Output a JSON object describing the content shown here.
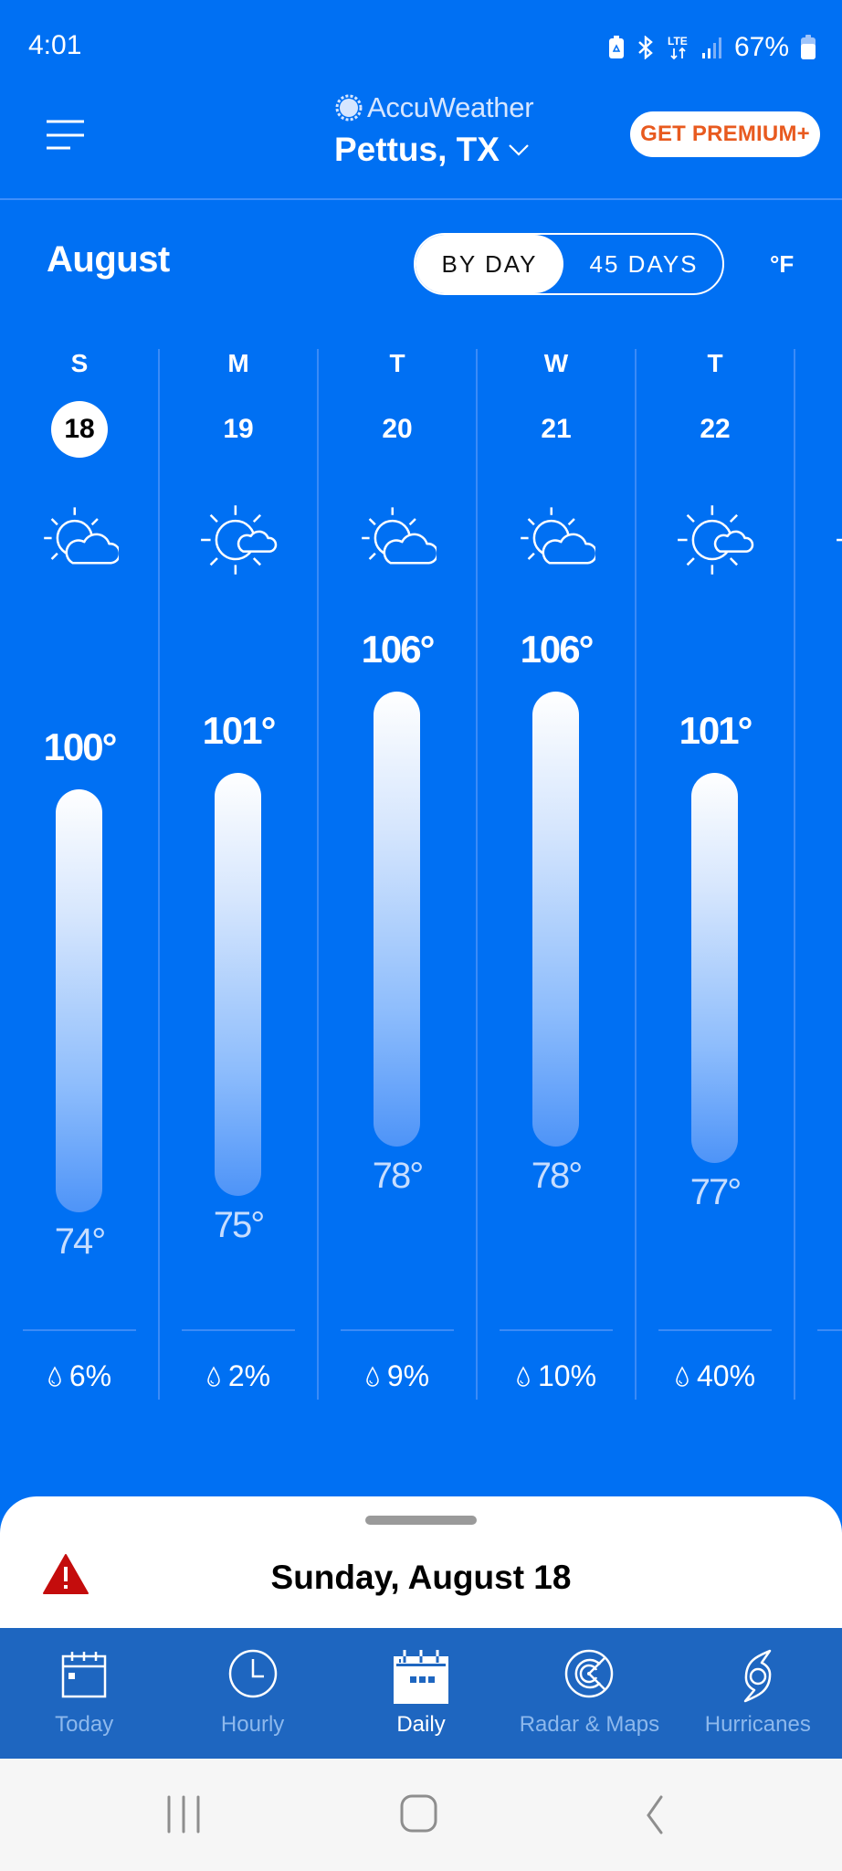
{
  "status_bar": {
    "time": "4:01",
    "icons": [
      "battery-saver-icon",
      "bluetooth-icon",
      "lte-icon",
      "signal-icon",
      "battery-icon"
    ],
    "battery_percent": "67%"
  },
  "header": {
    "menu_icon": "hamburger-menu-icon",
    "brand": "AccuWeather",
    "location": "Pettus, TX",
    "premium_button": "GET PREMIUM+",
    "colors": {
      "background": "#0070F3",
      "premium_text": "#E85A1F"
    }
  },
  "controls": {
    "month": "August",
    "view_options": [
      {
        "label": "BY DAY",
        "selected": true
      },
      {
        "label": "45 DAYS",
        "selected": false
      }
    ],
    "unit": "°F"
  },
  "days": [
    {
      "dow": "S",
      "date": "18",
      "selected": true,
      "icon": "mostly-cloudy-icon",
      "high": 100,
      "low": 74,
      "high_label": "100°",
      "low_label": "74°",
      "precip": "6%"
    },
    {
      "dow": "M",
      "date": "19",
      "selected": false,
      "icon": "partly-sunny-icon",
      "high": 101,
      "low": 75,
      "high_label": "101°",
      "low_label": "75°",
      "precip": "2%"
    },
    {
      "dow": "T",
      "date": "20",
      "selected": false,
      "icon": "mostly-cloudy-icon",
      "high": 106,
      "low": 78,
      "high_label": "106°",
      "low_label": "78°",
      "precip": "9%"
    },
    {
      "dow": "W",
      "date": "21",
      "selected": false,
      "icon": "mostly-cloudy-icon",
      "high": 106,
      "low": 78,
      "high_label": "106°",
      "low_label": "78°",
      "precip": "10%"
    },
    {
      "dow": "T",
      "date": "22",
      "selected": false,
      "icon": "partly-sunny-icon",
      "high": 101,
      "low": 77,
      "high_label": "101°",
      "low_label": "77°",
      "precip": "40%"
    }
  ],
  "sheet": {
    "alert_icon": "warning-icon",
    "title": "Sunday, August 18"
  },
  "nav": {
    "items": [
      {
        "label": "Today",
        "icon": "calendar-today-icon",
        "active": false
      },
      {
        "label": "Hourly",
        "icon": "clock-icon",
        "active": false
      },
      {
        "label": "Daily",
        "icon": "calendar-daily-icon",
        "active": true
      },
      {
        "label": "Radar & Maps",
        "icon": "radar-icon",
        "active": false
      },
      {
        "label": "Hurricanes",
        "icon": "hurricane-icon",
        "active": false
      }
    ]
  },
  "system_nav": [
    "recents-button",
    "home-button",
    "back-button"
  ]
}
